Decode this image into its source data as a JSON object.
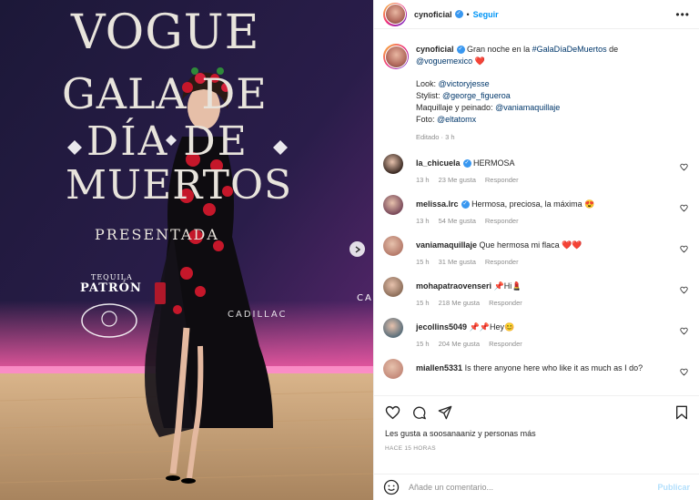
{
  "post": {
    "username": "cynoficial",
    "follow_label": "Seguir",
    "separator": "•",
    "more": "•••"
  },
  "photo": {
    "backdrop_title": "VOGUE",
    "backdrop_line1": "GALA DE",
    "backdrop_line2": "DÍA DE",
    "backdrop_line3": "MUERTOS",
    "backdrop_presents": "PRESENTADA",
    "sponsor1": "TEQUILA",
    "sponsor2": "PATRÓN",
    "sponsor3": "CADILLAC",
    "sponsor4": "CA"
  },
  "caption": {
    "username": "cynoficial",
    "text_a": "Gran noche en la ",
    "hashtag": "#GalaDíaDeMuertos",
    "text_b": " de",
    "mention_vogue": "@voguemexico",
    "emoji_heart": "❤️",
    "look_label": "Look: ",
    "look_handle": "@victoryjesse",
    "stylist_label": "Stylist: ",
    "stylist_handle": "@george_figueroa",
    "makeup_label": "Maquillaje y peinado: ",
    "makeup_handle": "@vaniamaquillaje",
    "photo_label": "Foto: ",
    "photo_handle": "@eltatomx",
    "edited": "Editado · 3 h"
  },
  "comments": [
    {
      "user": "la_chicuela",
      "verified": true,
      "text": "HERMOSA",
      "time": "13 h",
      "likes": "23 Me gusta",
      "reply": "Responder",
      "color": "#3b2a23"
    },
    {
      "user": "melissa.lrc",
      "verified": true,
      "text": "Hermosa, preciosa, la máxima 😍",
      "time": "13 h",
      "likes": "54 Me gusta",
      "reply": "Responder",
      "color": "#7a4a5a"
    },
    {
      "user": "vaniamaquillaje",
      "verified": false,
      "text": "Que hermosa mi flaca ❤️❤️",
      "time": "15 h",
      "likes": "31 Me gusta",
      "reply": "Responder",
      "color": "#b57a6a"
    },
    {
      "user": "mohapatraovenseri",
      "verified": false,
      "text": "📌Hi💄",
      "time": "15 h",
      "likes": "218 Me gusta",
      "reply": "Responder",
      "color": "#8d6e5a"
    },
    {
      "user": "jecollins5049",
      "verified": false,
      "text": "📌📌Hey😊",
      "time": "15 h",
      "likes": "204 Me gusta",
      "reply": "Responder",
      "color": "#5a6e7a"
    },
    {
      "user": "miallen5331",
      "verified": false,
      "text": "Is there anyone here who like it as much as I do?",
      "time": "",
      "likes": "",
      "reply": "",
      "color": "#c48a7a"
    }
  ],
  "actions": {
    "likes_text": "Les gusta a soosanaaniz y personas más",
    "timestamp": "HACE 15 HORAS"
  },
  "add_comment": {
    "placeholder": "Añade un comentario...",
    "post_label": "Publicar"
  }
}
